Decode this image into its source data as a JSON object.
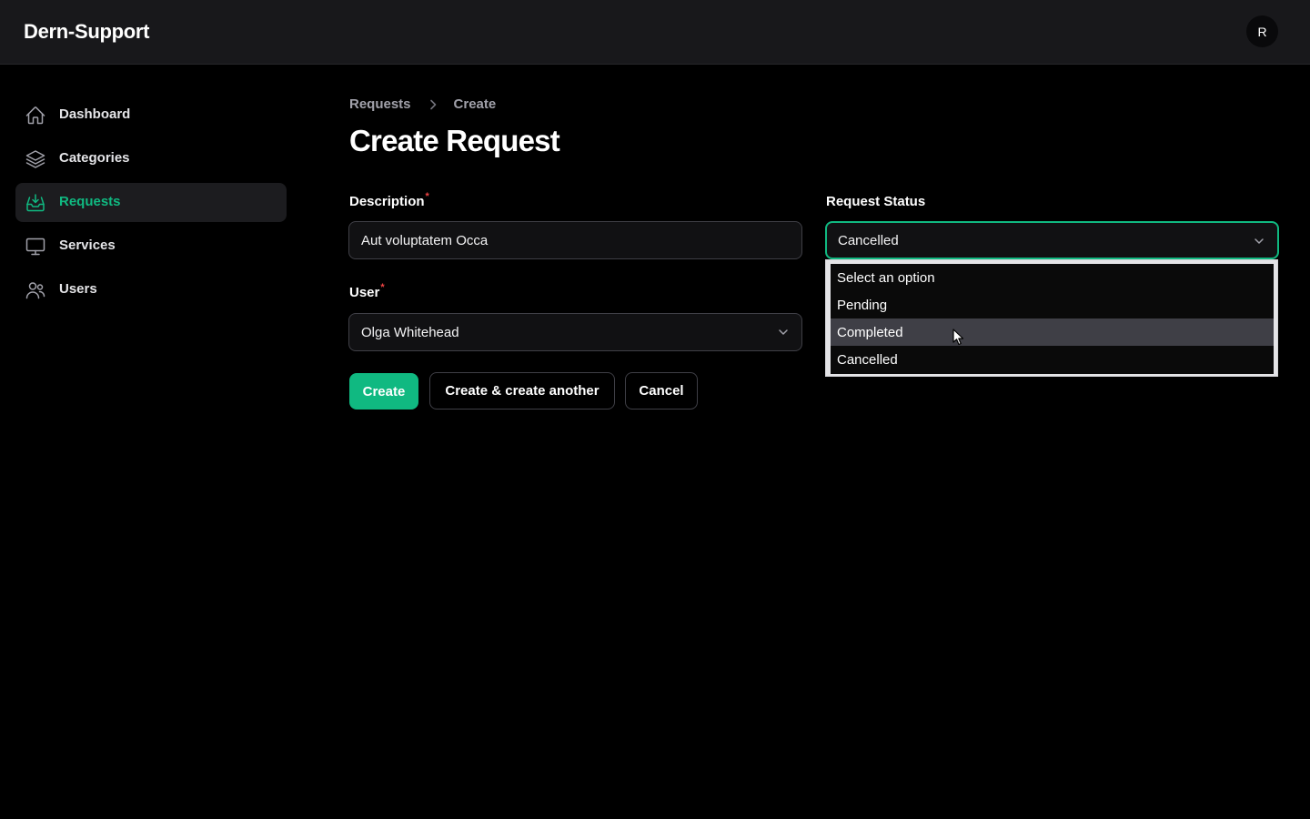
{
  "app": {
    "title": "Dern-Support",
    "avatar_initial": "R"
  },
  "sidebar": {
    "items": [
      {
        "label": "Dashboard",
        "icon": "home-icon",
        "active": false
      },
      {
        "label": "Categories",
        "icon": "layers-icon",
        "active": false
      },
      {
        "label": "Requests",
        "icon": "inbox-download-icon",
        "active": true
      },
      {
        "label": "Services",
        "icon": "monitor-icon",
        "active": false
      },
      {
        "label": "Users",
        "icon": "users-icon",
        "active": false
      }
    ]
  },
  "breadcrumb": {
    "items": [
      "Requests",
      "Create"
    ]
  },
  "page": {
    "title": "Create Request"
  },
  "form": {
    "description": {
      "label": "Description",
      "required_mark": "*",
      "value": "Aut voluptatem Occa"
    },
    "user": {
      "label": "User",
      "required_mark": "*",
      "value": "Olga Whitehead"
    },
    "status": {
      "label": "Request Status",
      "value": "Cancelled",
      "options": [
        "Select an option",
        "Pending",
        "Completed",
        "Cancelled"
      ],
      "hovered_option": "Completed"
    }
  },
  "actions": {
    "create": "Create",
    "create_another": "Create & create another",
    "cancel": "Cancel"
  },
  "colors": {
    "accent": "#10b981",
    "background": "#000000",
    "topbar": "#18181b",
    "required": "#ef4444"
  }
}
